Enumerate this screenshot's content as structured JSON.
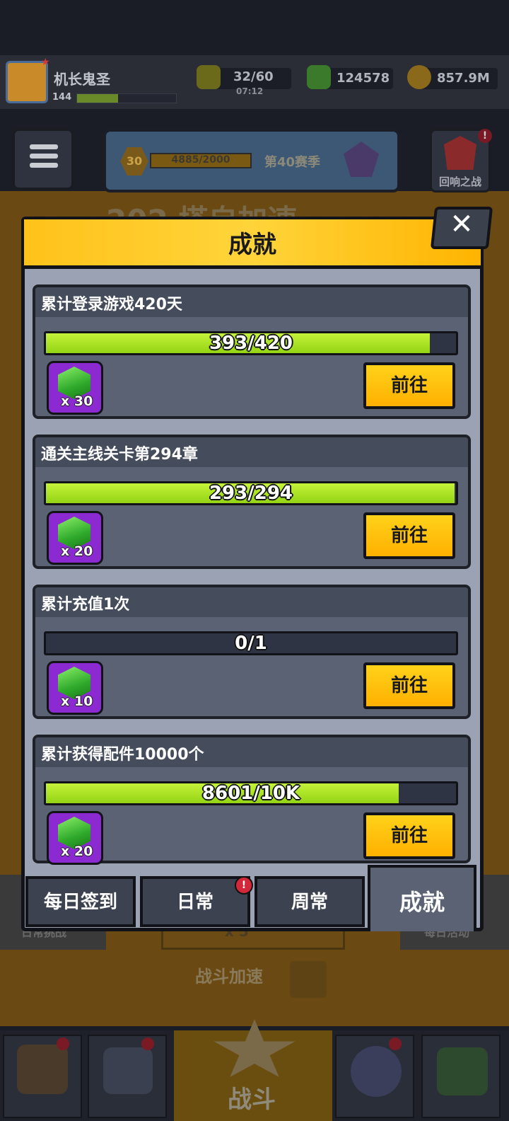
{
  "player": {
    "name": "机长鬼圣",
    "level": "144",
    "xp_progress": 0.4
  },
  "resources": {
    "energy": "32/60",
    "energy_timer": "07:12",
    "gems": "124578",
    "coins": "857.9M"
  },
  "season": {
    "level": "30",
    "progress": "4885/2000",
    "name": "第40赛季"
  },
  "echo_battle": {
    "label": "回响之战",
    "badge": "!"
  },
  "background": {
    "title": "202 塔自加速",
    "left_tab": "日常挑战",
    "right_tab": "每日活动",
    "speed_multiplier": "x 5",
    "battle_speed": "战斗加速"
  },
  "bottom_nav": {
    "battle": "战斗"
  },
  "modal": {
    "title": "成就",
    "close": "✕",
    "achievements": [
      {
        "title": "累计登录游戏420天",
        "progress_text": "393/420",
        "progress": 0.9357,
        "reward_qty": "x 30",
        "button": "前往"
      },
      {
        "title": "通关主线关卡第294章",
        "progress_text": "293/294",
        "progress": 0.9966,
        "reward_qty": "x 20",
        "button": "前往"
      },
      {
        "title": "累计充值1次",
        "progress_text": "0/1",
        "progress": 0,
        "reward_qty": "x 10",
        "button": "前往"
      },
      {
        "title": "累计获得配件10000个",
        "progress_text": "8601/10K",
        "progress": 0.8601,
        "reward_qty": "x 20",
        "button": "前往"
      }
    ],
    "tabs": [
      {
        "label": "每日签到"
      },
      {
        "label": "日常",
        "badge": "!"
      },
      {
        "label": "周常"
      },
      {
        "label": "成就",
        "active": true
      }
    ]
  },
  "colors": {
    "accent": "#ffc21a",
    "progress": "#b4e81e",
    "panel": "#5a6274",
    "reward_bg": "#8a2ad0"
  }
}
